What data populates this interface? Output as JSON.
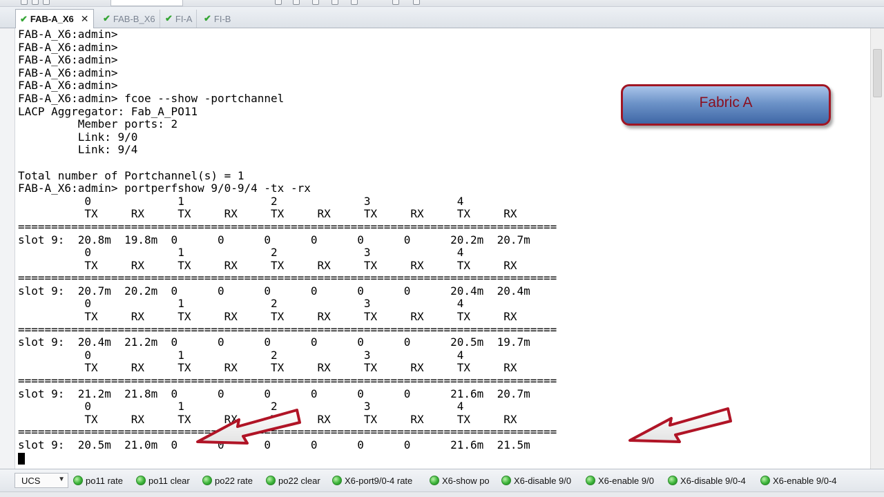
{
  "tabs": [
    {
      "label": "FAB-A_X6",
      "active": true,
      "close": "✕"
    },
    {
      "label": "FAB-B_X6",
      "active": false
    },
    {
      "label": "FI-A",
      "active": false
    },
    {
      "label": "FI-B",
      "active": false
    }
  ],
  "terminal": {
    "lines": [
      "FAB-A_X6:admin>",
      "FAB-A_X6:admin>",
      "FAB-A_X6:admin>",
      "FAB-A_X6:admin>",
      "FAB-A_X6:admin>",
      "FAB-A_X6:admin> fcoe --show -portchannel",
      "LACP Aggregator: Fab_A_PO11",
      "         Member ports: 2",
      "         Link: 9/0",
      "         Link: 9/4",
      "",
      "Total number of Portchannel(s) = 1",
      "FAB-A_X6:admin> portperfshow 9/0-9/4 -tx -rx",
      "          0             1             2             3             4",
      "          TX     RX     TX     RX     TX     RX     TX     RX     TX     RX",
      "=================================================================================",
      "slot 9:  20.8m  19.8m  0      0      0      0      0      0      20.2m  20.7m",
      "          0             1             2             3             4",
      "          TX     RX     TX     RX     TX     RX     TX     RX     TX     RX",
      "=================================================================================",
      "slot 9:  20.7m  20.2m  0      0      0      0      0      0      20.4m  20.4m",
      "          0             1             2             3             4",
      "          TX     RX     TX     RX     TX     RX     TX     RX     TX     RX",
      "=================================================================================",
      "slot 9:  20.4m  21.2m  0      0      0      0      0      0      20.5m  19.7m",
      "          0             1             2             3             4",
      "          TX     RX     TX     RX     TX     RX     TX     RX     TX     RX",
      "=================================================================================",
      "slot 9:  21.2m  21.8m  0      0      0      0      0      0      21.6m  20.7m",
      "          0             1             2             3             4",
      "          TX     RX     TX     RX     TX     RX     TX     RX     TX     RX",
      "=================================================================================",
      "slot 9:  20.5m  21.0m  0      0      0      0      0      0      21.6m  21.5m"
    ]
  },
  "callout": {
    "label": "Fabric A"
  },
  "bottombar": {
    "session_select": "UCS",
    "commands": [
      "po11 rate",
      "po11 clear",
      "po22 rate",
      "po22 clear",
      "X6-port9/0-4 rate",
      "X6-show po",
      "X6-disable 9/0",
      "X6-enable 9/0",
      "X6-disable 9/0-4",
      "X6-enable 9/0-4"
    ]
  },
  "colors": {
    "tab_check": "#35a535",
    "callout_border": "#a01624",
    "callout_fill": "#5a82bd",
    "arrow_red": "#b01426",
    "status_green": "#3db53a"
  }
}
